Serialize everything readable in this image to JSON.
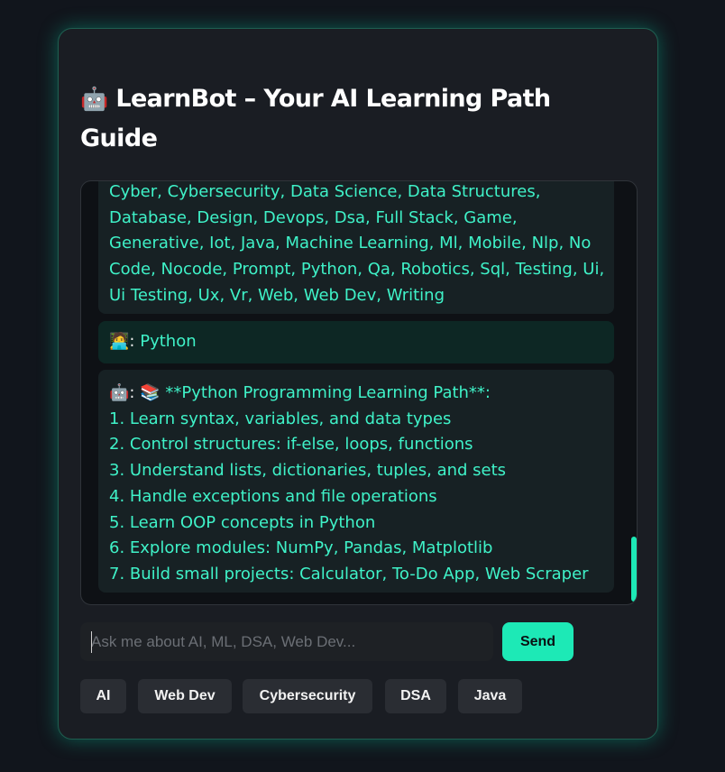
{
  "app": {
    "title_icon": "🤖",
    "title": "LearnBot – Your AI Learning Path Guide"
  },
  "messages": [
    {
      "role": "bot",
      "lines": [
        "Cyber, Cybersecurity, Data Science, Data Structures,",
        "Database, Design, Devops, Dsa, Full Stack, Game,",
        "Generative, Iot, Java, Machine Learning, Ml, Mobile, Nlp, No",
        "Code, Nocode, Prompt, Python, Qa, Robotics, Sql, Testing, Ui,",
        "Ui Testing, Ux, Vr, Web, Web Dev, Writing"
      ]
    },
    {
      "role": "user",
      "avatar": "🧑‍💻",
      "text": "Python"
    },
    {
      "role": "bot",
      "avatar": "🤖",
      "book_icon": "📚",
      "lines": [
        "**Python Programming Learning Path**:",
        "1. Learn syntax, variables, and data types",
        "2. Control structures: if-else, loops, functions",
        "3. Understand lists, dictionaries, tuples, and sets",
        "4. Handle exceptions and file operations",
        "5. Learn OOP concepts in Python",
        "6. Explore modules: NumPy, Pandas, Matplotlib",
        "7. Build small projects: Calculator, To-Do App, Web Scraper"
      ]
    }
  ],
  "input": {
    "placeholder": "Ask me about AI, ML, DSA, Web Dev...",
    "value": ""
  },
  "send_label": "Send",
  "chips": [
    "AI",
    "Web Dev",
    "Cybersecurity",
    "DSA",
    "Java"
  ],
  "colors": {
    "accent": "#1de9b6",
    "message_text": "#3ff2c8",
    "background": "#11151c",
    "card": "#1a1d23"
  }
}
